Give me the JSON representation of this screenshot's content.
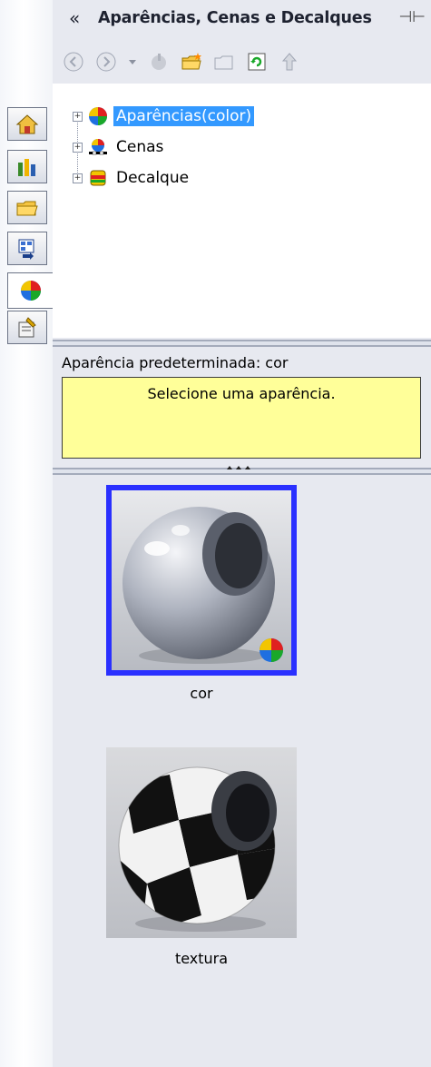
{
  "header": {
    "title": "Aparências, Cenas e Decalques"
  },
  "tree": {
    "items": [
      {
        "label": "Aparências(color)"
      },
      {
        "label": "Cenas"
      },
      {
        "label": "Decalque"
      }
    ]
  },
  "info": {
    "default_appearance": "Aparência predeterminada: cor",
    "message": "Selecione uma aparência."
  },
  "thumbnails": [
    {
      "caption": "cor"
    },
    {
      "caption": "textura"
    }
  ]
}
